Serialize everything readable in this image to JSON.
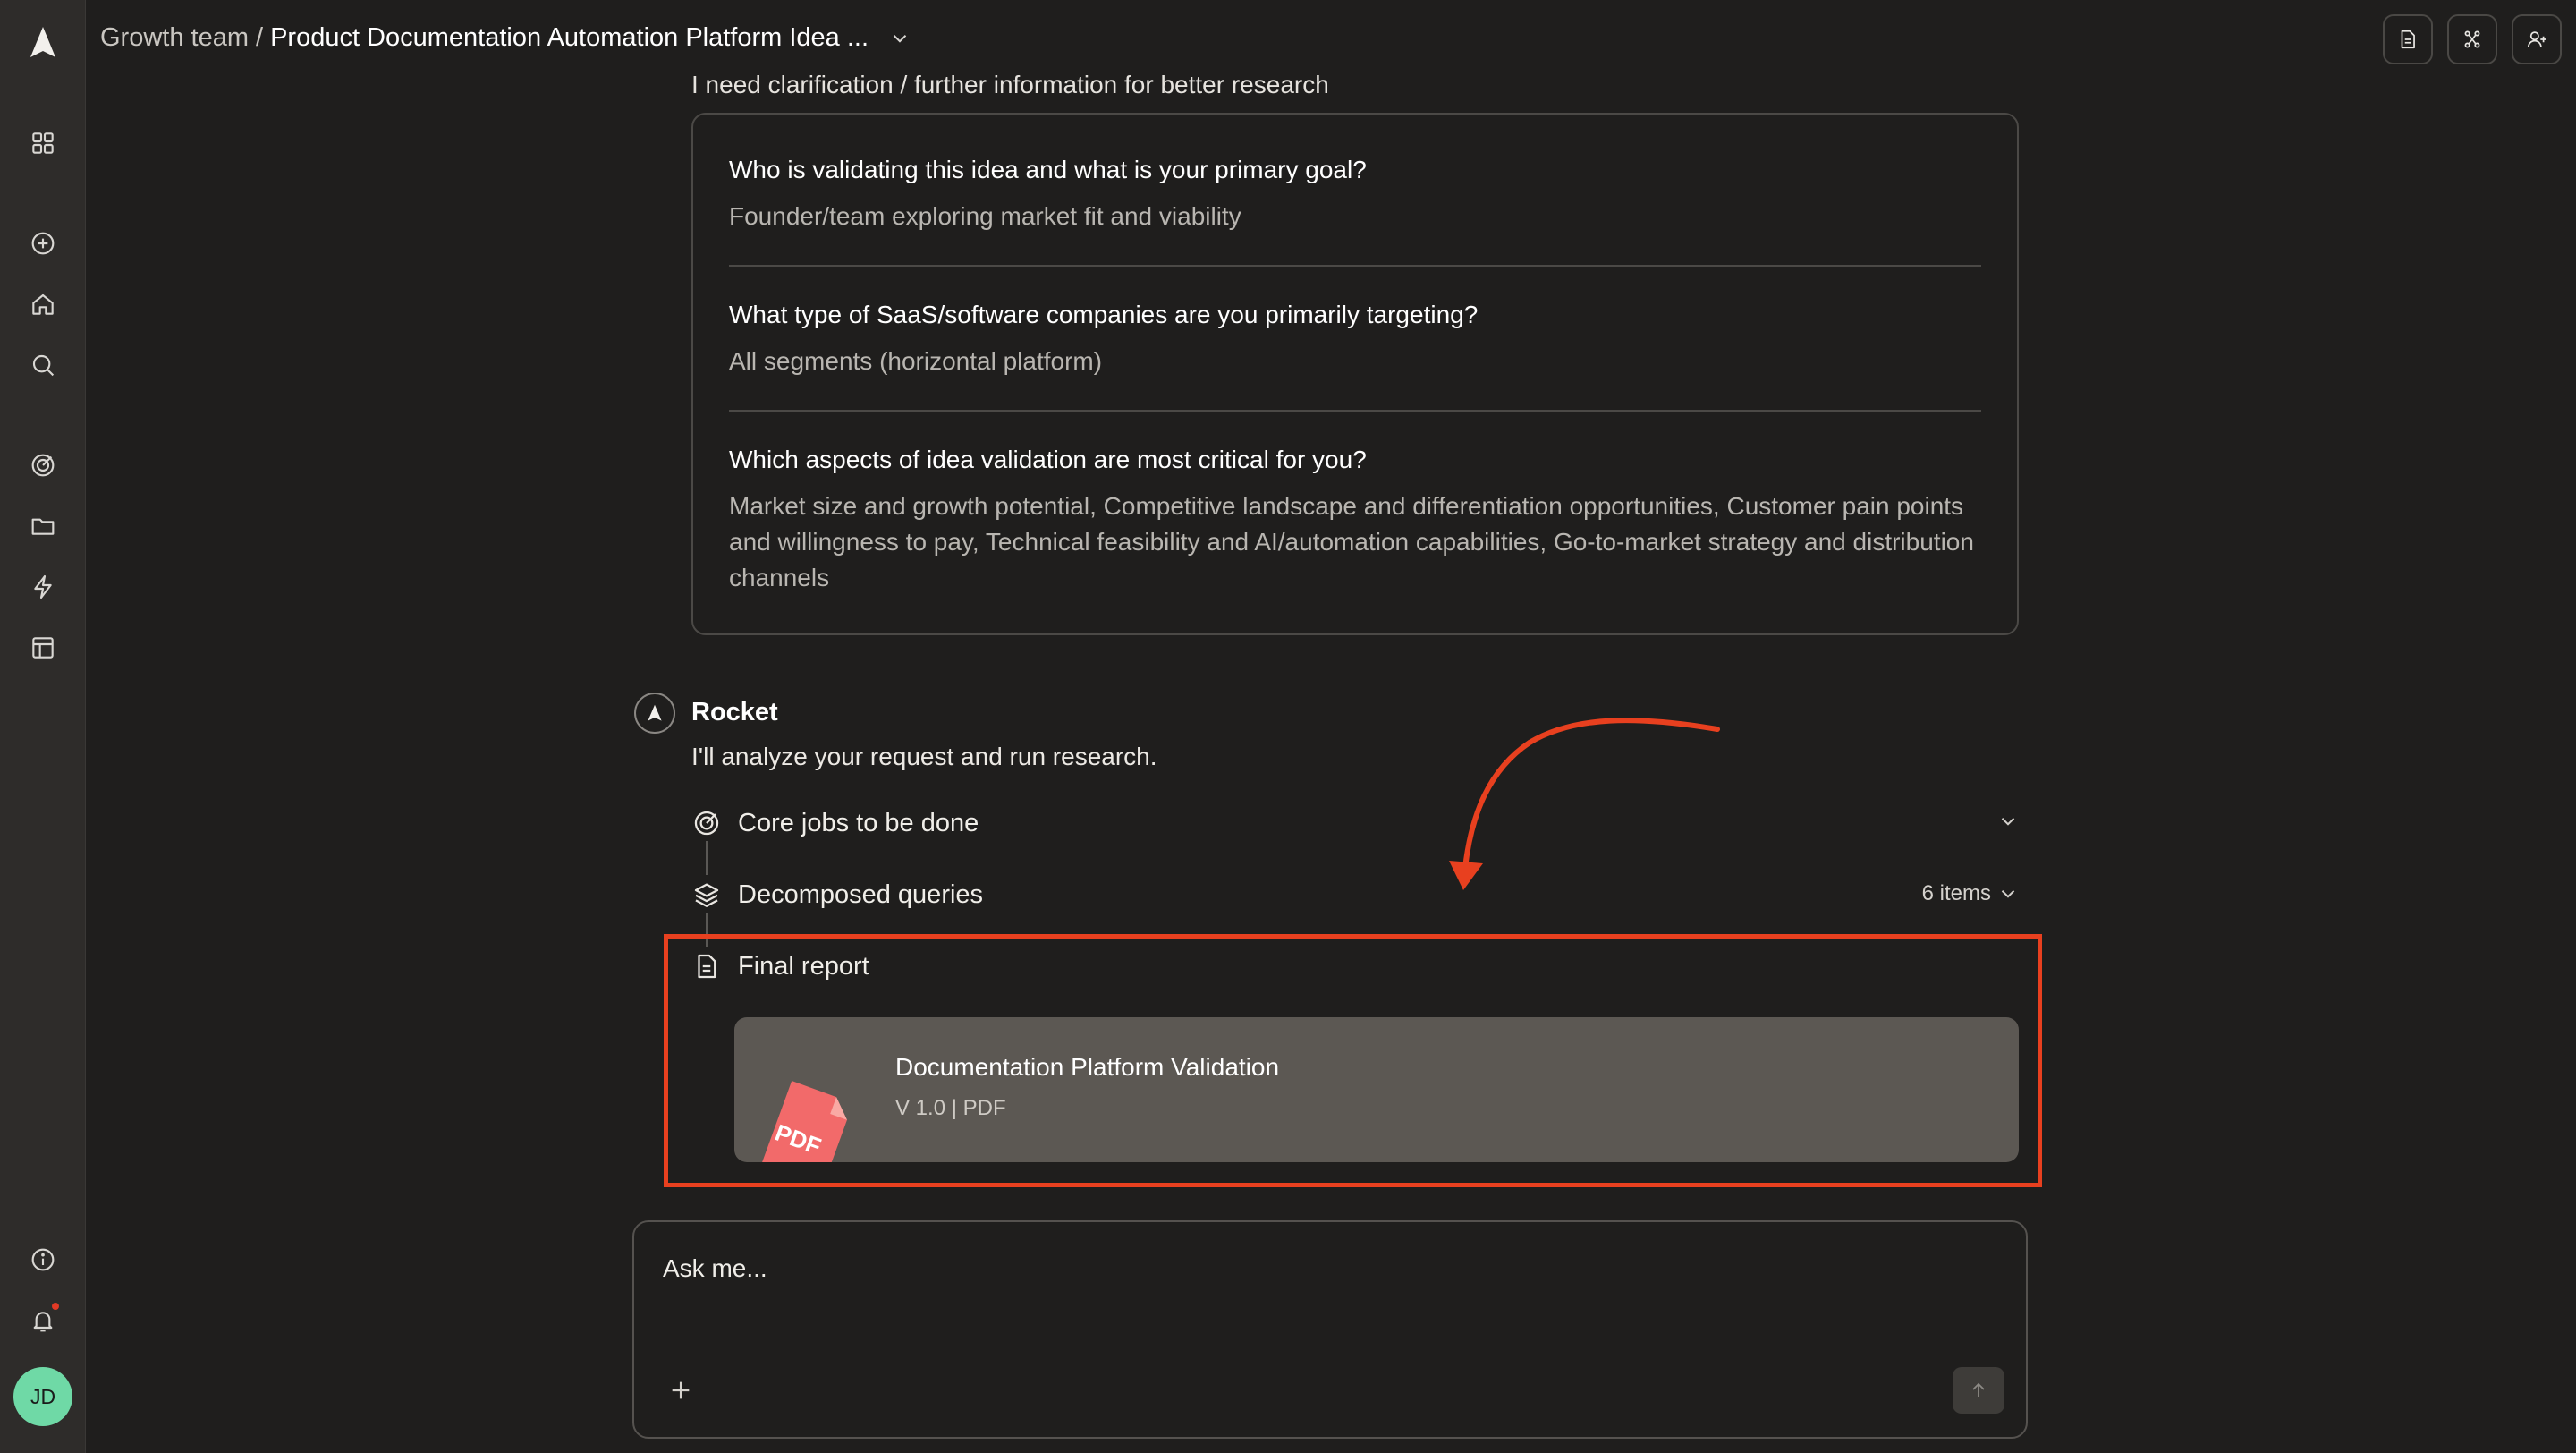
{
  "app": {
    "accent": "#e8401f",
    "avatar_color": "#6fd9a6"
  },
  "sidebar": {
    "items": [
      {
        "name": "dashboard",
        "icon": "grid-icon"
      },
      {
        "name": "new",
        "icon": "plus-circle-icon"
      },
      {
        "name": "home",
        "icon": "home-icon"
      },
      {
        "name": "search",
        "icon": "search-icon"
      },
      {
        "name": "goals",
        "icon": "target-icon"
      },
      {
        "name": "projects",
        "icon": "folder-icon"
      },
      {
        "name": "automations",
        "icon": "lightning-icon"
      },
      {
        "name": "templates",
        "icon": "layout-icon"
      },
      {
        "name": "info",
        "icon": "info-icon"
      },
      {
        "name": "notifications",
        "icon": "bell-icon"
      }
    ],
    "user_initials": "JD"
  },
  "header": {
    "team": "Growth team",
    "separator": "/",
    "title": "Product Documentation Automation Platform Idea ..."
  },
  "conversation": {
    "clarification_heading": "I need clarification / further information for better research",
    "qa": [
      {
        "question": "Who is validating this idea and what is your primary goal?",
        "answer": "Founder/team exploring market fit and viability"
      },
      {
        "question": "What type of SaaS/software companies are you primarily targeting?",
        "answer": "All segments (horizontal platform)"
      },
      {
        "question": "Which aspects of idea validation are most critical for you?",
        "answer": "Market size and growth potential, Competitive landscape and differentiation opportunities, Customer pain points and willingness to pay, Technical feasibility and AI/automation capabilities, Go-to-market strategy and distribution channels"
      }
    ],
    "assistant": {
      "name": "Rocket",
      "message": "I'll analyze your request and run research."
    },
    "steps": [
      {
        "label": "Core jobs to be done",
        "icon": "target-icon"
      },
      {
        "label": "Decomposed queries",
        "icon": "layers-icon",
        "count": "6 items"
      },
      {
        "label": "Final report",
        "icon": "document-icon"
      }
    ],
    "report": {
      "title": "Documentation Platform Validation",
      "meta": "V 1.0 | PDF",
      "badge": "PDF"
    }
  },
  "composer": {
    "placeholder": "Ask me..."
  }
}
